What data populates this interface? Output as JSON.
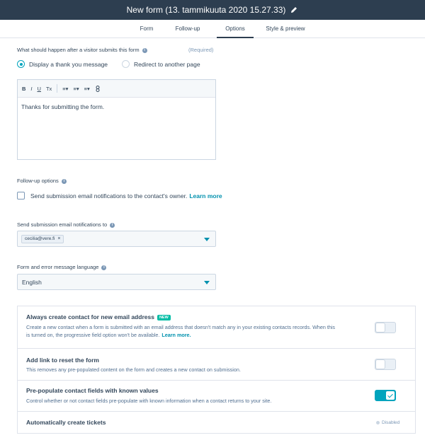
{
  "header": {
    "title": "New form (13. tammikuuta 2020 15.27.33)",
    "edit_icon": "pencil-icon"
  },
  "tabs": [
    {
      "label": "Form",
      "active": false
    },
    {
      "label": "Follow-up",
      "active": false
    },
    {
      "label": "Options",
      "active": true
    },
    {
      "label": "Style & preview",
      "active": false
    }
  ],
  "submit_action": {
    "label": "What should happen after a visitor submits this form",
    "required": "(Required)",
    "options": [
      {
        "label": "Display a thank you message",
        "selected": true
      },
      {
        "label": "Redirect to another page",
        "selected": false
      }
    ],
    "toolbar": [
      "B",
      "I",
      "U",
      "Tx",
      "≡▾",
      "≡▾",
      "≡▾",
      "🔗"
    ],
    "message": "Thanks for submitting the form."
  },
  "followup": {
    "label": "Follow-up options",
    "checkbox_label": "Send submission email notifications to the contact's owner.",
    "link": "Learn more"
  },
  "notifications": {
    "label": "Send submission email notifications to",
    "chip": "cecilia@vere.fi"
  },
  "language": {
    "label": "Form and error message language",
    "value": "English"
  },
  "settings": [
    {
      "title": "Always create contact for new email address",
      "badge": "NEW",
      "description": "Create a new contact when a form is submitted with an email address that doesn't match any in your existing contacts records. When this is turned on, the progressive field option won't be available.",
      "link": "Learn more.",
      "enabled": false
    },
    {
      "title": "Add link to reset the form",
      "description": "This removes any pre-populated content on the form and creates a new contact on submission.",
      "enabled": false
    },
    {
      "title": "Pre-populate contact fields with known values",
      "description": "Control whether or not contact fields pre-populate with known information when a contact returns to your site.",
      "enabled": true
    },
    {
      "title": "Automatically create tickets",
      "status": "Disabled"
    }
  ],
  "colors": {
    "topbar": "#2d3e50",
    "accent": "#00a4bd",
    "link": "#0091ae",
    "badge": "#00bda5"
  }
}
